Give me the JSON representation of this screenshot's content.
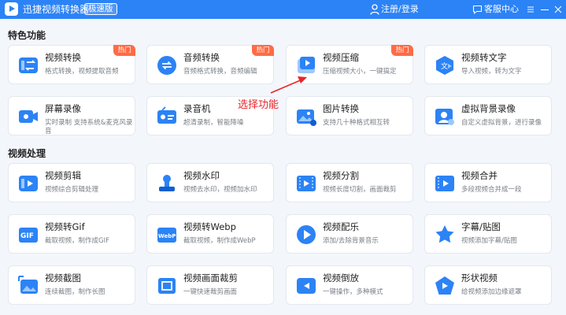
{
  "titlebar": {
    "app_title": "迅捷视频转换器",
    "badge": "极速版",
    "login": "注册/登录",
    "service": "客服中心",
    "color": "#2c83f5"
  },
  "annotation": "选择功能",
  "sections": [
    {
      "title": "特色功能",
      "cards": [
        {
          "name": "视频转换",
          "desc": "格式转换，视频提取音频",
          "hot": "热门",
          "icon": "video-convert-icon"
        },
        {
          "name": "音频转换",
          "desc": "音频格式转换，音频编辑",
          "hot": "热门",
          "icon": "audio-convert-icon"
        },
        {
          "name": "视频压缩",
          "desc": "压缩视频大小，一键搞定",
          "hot": "热门",
          "icon": "video-compress-icon"
        },
        {
          "name": "视频转文字",
          "desc": "导入视频，转为文字",
          "hot": "",
          "icon": "video-to-text-icon"
        },
        {
          "name": "屏幕录像",
          "desc": "实时录制 支持系统&麦克风录音",
          "hot": "",
          "icon": "screen-record-icon"
        },
        {
          "name": "录音机",
          "desc": "超清录制，智能降噪",
          "hot": "",
          "icon": "recorder-icon"
        },
        {
          "name": "图片转换",
          "desc": "支持几十种格式相互转",
          "hot": "",
          "icon": "image-convert-icon"
        },
        {
          "name": "虚拟背景录像",
          "desc": "自定义虚拟背景，进行录像",
          "hot": "",
          "icon": "virtual-background-icon"
        }
      ]
    },
    {
      "title": "视频处理",
      "cards": [
        {
          "name": "视频剪辑",
          "desc": "视频综合剪辑处理",
          "hot": "",
          "icon": "video-edit-icon"
        },
        {
          "name": "视频水印",
          "desc": "视频去水印，视频加水印",
          "hot": "",
          "icon": "watermark-icon"
        },
        {
          "name": "视频分割",
          "desc": "视频长度切割，画面裁剪",
          "hot": "",
          "icon": "video-split-icon"
        },
        {
          "name": "视频合并",
          "desc": "多段视频合并成一段",
          "hot": "",
          "icon": "video-merge-icon"
        },
        {
          "name": "视频转Gif",
          "desc": "截取视频，制作成GIF",
          "hot": "",
          "icon": "gif-icon"
        },
        {
          "name": "视频转Webp",
          "desc": "截取视频，制作成WebP",
          "hot": "",
          "icon": "webp-icon"
        },
        {
          "name": "视频配乐",
          "desc": "添加/去除背景音乐",
          "hot": "",
          "icon": "music-icon"
        },
        {
          "name": "字幕/贴图",
          "desc": "视频添加字幕/贴图",
          "hot": "",
          "icon": "subtitle-sticker-icon"
        },
        {
          "name": "视频截图",
          "desc": "连续截图，制作长图",
          "hot": "",
          "icon": "screenshot-icon"
        },
        {
          "name": "视频画面裁剪",
          "desc": "一键快速裁剪画面",
          "hot": "",
          "icon": "crop-icon"
        },
        {
          "name": "视频倒放",
          "desc": "一键操作，多种模式",
          "hot": "",
          "icon": "reverse-icon"
        },
        {
          "name": "形状视频",
          "desc": "给视频添加边缘遮罩",
          "hot": "",
          "icon": "shape-video-icon"
        }
      ]
    }
  ]
}
